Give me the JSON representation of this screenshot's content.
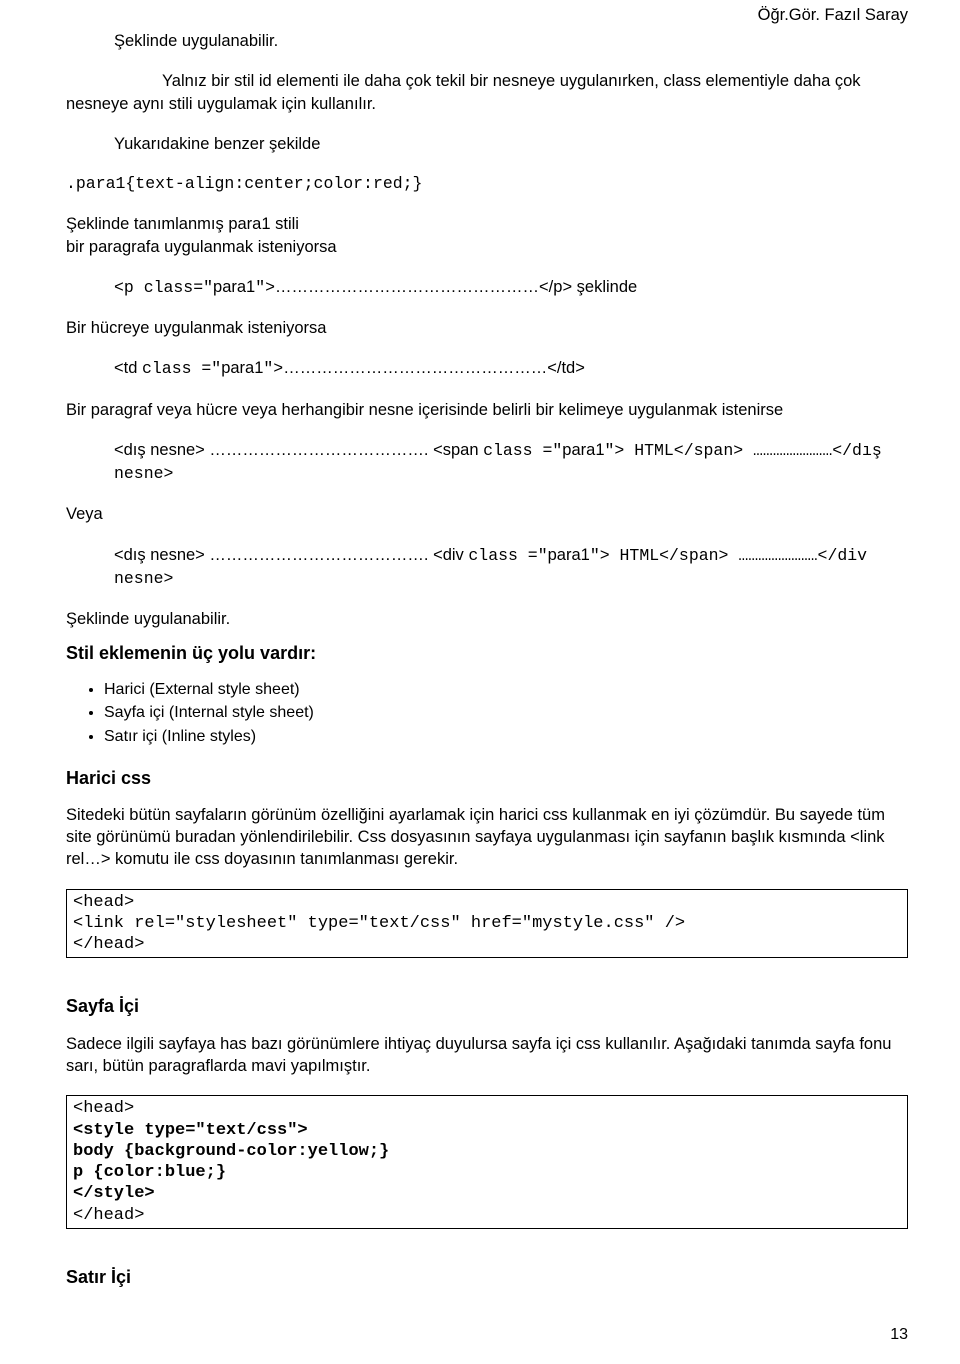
{
  "header_author": "Öğr.Gör. Fazıl Saray",
  "p_intro1": "Şeklinde uygulanabilir.",
  "p_intro2": "Yalnız bir stil id elementi ile daha çok tekil bir nesneye uygulanırken, class elementiyle daha çok nesneye aynı stili uygulamak için kullanılır.",
  "p_intro3": "Yukarıdakine benzer şekilde",
  "code1": ".para1{text-align:center;color:red;}",
  "p_desc1a": "Şeklinde tanımlanmış para1 stili",
  "p_desc1b": "bir paragrafa uygulanmak isteniyorsa",
  "code2_a": "<p class=\"",
  "code2_b": "para1",
  "code2_c": "\">",
  "code2_suffix": "…………………………………………</p> şeklinde",
  "p_desc2": "Bir hücreye uygulanmak isteniyorsa",
  "code3_a": "<td ",
  "code3_b": "class =\"",
  "code3_c": "para1",
  "code3_d": "\">",
  "code3_suffix": "…………………………………………</td>",
  "p_desc3": "Bir paragraf veya hücre veya herhangibir nesne içerisinde belirli bir kelimeye uygulanmak istenirse",
  "code4_pre": "<dış nesne> …………………………………. <span ",
  "code4_mid": "class =\"",
  "code4_val": "para1",
  "code4_post": "\"> HTML</span> ……………………</dış nesne>",
  "p_veya": "Veya",
  "code5_pre": "<dış nesne> …………………………………. <div ",
  "code5_mid": "class =\"",
  "code5_val": "para1",
  "code5_post": "\"> HTML</span> ……………………</div nesne>",
  "p_closing": "Şeklinde uygulanabilir.",
  "h_methods": "Stil eklemenin üç yolu vardır:",
  "bullets": [
    "Harici (External style sheet)",
    "Sayfa içi (Internal style sheet)",
    "Satır içi (Inline styles)"
  ],
  "h_harici": "Harici css",
  "p_harici": "Sitedeki bütün sayfaların görünüm özelliğini ayarlamak için harici css kullanmak en iyi çözümdür. Bu sayede tüm site görünümü buradan yönlendirilebilir. Css dosyasının sayfaya uygulanması için sayfanın başlık kısmında <link rel…> komutu ile css doyasının tanımlanması gerekir.",
  "codebox1_l1": "<head>",
  "codebox1_l2": "<link rel=\"stylesheet\" type=\"text/css\" href=\"mystyle.css\" />",
  "codebox1_l3": "</head>",
  "h_sayfa": "Sayfa İçi",
  "p_sayfa": "Sadece ilgili sayfaya has bazı görünümlere ihtiyaç duyulursa sayfa içi css kullanılır. Aşağıdaki tanımda sayfa fonu sarı, bütün paragraflarda mavi yapılmıştır.",
  "codebox2_l1": "<head>",
  "codebox2_l2": "<style type=\"text/css\">",
  "codebox2_l3": "body {background-color:yellow;}",
  "codebox2_l4": "p {color:blue;}",
  "codebox2_l5": "</style>",
  "codebox2_l6": "</head>",
  "h_satir": "Satır İçi",
  "page_number": "13"
}
